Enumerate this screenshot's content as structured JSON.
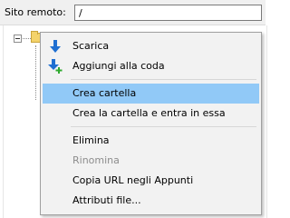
{
  "header": {
    "remote_label": "Sito remoto:",
    "remote_path": "/"
  },
  "context_menu": {
    "items": [
      {
        "label": "Scarica",
        "icon": "download-arrow-icon",
        "state": "normal"
      },
      {
        "label": "Aggiungi alla coda",
        "icon": "add-to-queue-icon",
        "state": "normal"
      },
      {
        "label": "Crea cartella",
        "state": "highlighted"
      },
      {
        "label": "Crea la cartella e entra in essa",
        "state": "normal"
      },
      {
        "label": "Elimina",
        "state": "normal"
      },
      {
        "label": "Rinomina",
        "state": "disabled"
      },
      {
        "label": "Copia URL negli Appunti",
        "state": "normal"
      },
      {
        "label": "Attributi file...",
        "state": "normal"
      }
    ]
  },
  "colors": {
    "highlight": "#91c9f7",
    "icon_blue": "#1f6fd1",
    "icon_green": "#2faa2f",
    "disabled_text": "#8d8d8d"
  }
}
